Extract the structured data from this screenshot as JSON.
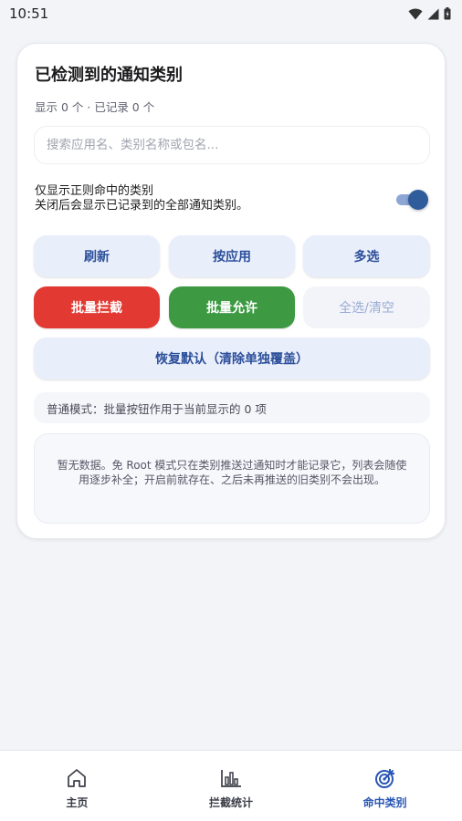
{
  "status_bar": {
    "time": "10:51"
  },
  "card": {
    "title": "已检测到的通知类别",
    "subtitle": "显示 0 个 · 已记录 0 个",
    "search": {
      "placeholder": "搜索应用名、类别名称或包名...",
      "value": ""
    },
    "toggle": {
      "label": "仅显示正则命中的类别",
      "description": "关闭后会显示已记录到的全部通知类别。",
      "on": true
    },
    "buttons": {
      "refresh": "刷新",
      "by_app": "按应用",
      "multi_select": "多选",
      "batch_block": "批量拦截",
      "batch_allow": "批量允许",
      "select_all_clear": "全选/清空",
      "restore_default": "恢复默认（清除单独覆盖）"
    },
    "mode_text": "普通模式：批量按钮作用于当前显示的 0 项",
    "empty_text": "暂无数据。免 Root 模式只在类别推送过通知时才能记录它，列表会随使用逐步补全；开启前就存在、之后未再推送的旧类别不会出现。"
  },
  "bottom_nav": {
    "items": [
      {
        "label": "主页",
        "icon": "home-icon"
      },
      {
        "label": "拦截统计",
        "icon": "bar-chart-icon"
      },
      {
        "label": "命中类别",
        "icon": "target-icon"
      }
    ],
    "active_index": 2
  },
  "colors": {
    "accent": "#2a57b5",
    "danger": "#e23a33",
    "success": "#3d9a42"
  }
}
